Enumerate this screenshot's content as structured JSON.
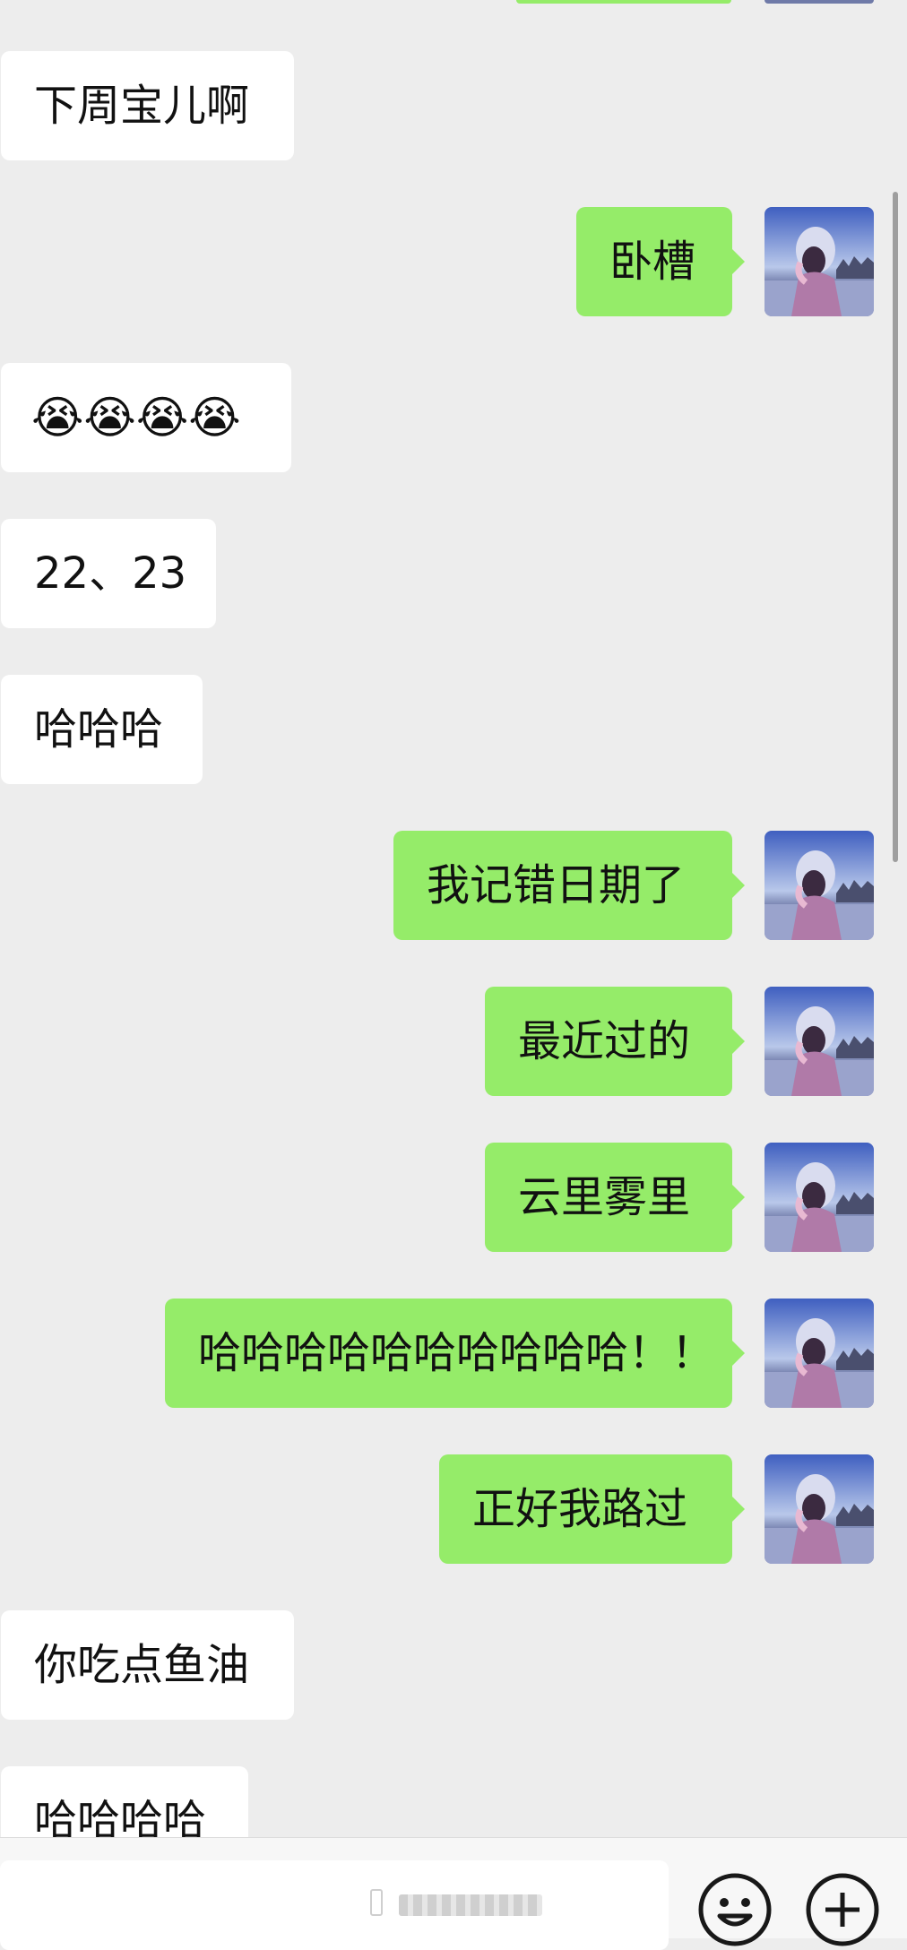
{
  "messages": [
    {
      "side": "in",
      "text": "下周宝儿啊"
    },
    {
      "side": "out",
      "text": "卧槽"
    },
    {
      "side": "in",
      "text": "😭😭😭😭"
    },
    {
      "side": "in",
      "text": "22、23"
    },
    {
      "side": "in",
      "text": "哈哈哈"
    },
    {
      "side": "out",
      "text": "我记错日期了"
    },
    {
      "side": "out",
      "text": "最近过的"
    },
    {
      "side": "out",
      "text": "云里雾里"
    },
    {
      "side": "out",
      "text": "哈哈哈哈哈哈哈哈哈哈！！"
    },
    {
      "side": "out",
      "text": "正好我路过"
    },
    {
      "side": "in",
      "text": "你吃点鱼油"
    },
    {
      "side": "in",
      "text": "哈哈哈哈"
    }
  ],
  "input_bar": {
    "emoji_icon": "smiley-icon",
    "more_icon": "plus-circle-icon"
  },
  "colors": {
    "outgoing": "#95ec69",
    "incoming": "#ffffff",
    "background": "#ededed"
  }
}
